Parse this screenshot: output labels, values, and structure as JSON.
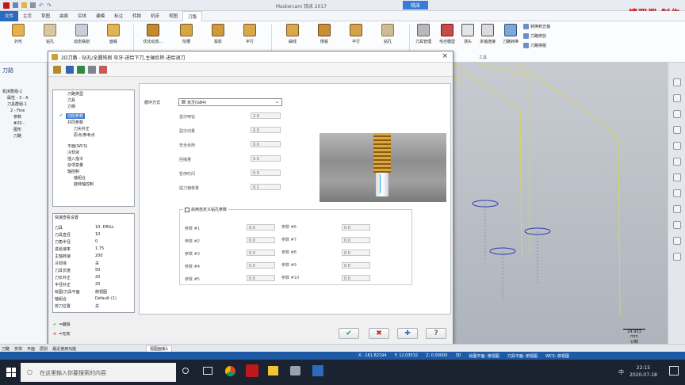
{
  "app": {
    "title": "Mastercam 铣床 2017",
    "ribbon_tab": "铣床",
    "brand": "禧瑕阁 制作"
  },
  "menu": [
    "文件",
    "主页",
    "草图",
    "曲面",
    "实体",
    "建模",
    "标注",
    "转换",
    "机床",
    "视图",
    "刀路"
  ],
  "ribbon": {
    "buttons": [
      "外形",
      "钻孔",
      "动态铣削",
      "面铣",
      "优化动态...",
      "挖槽",
      "投影",
      "平行",
      "曲线",
      "侧铣",
      "平行",
      "钻孔",
      "刀具管理",
      "毛坯模型",
      "测头",
      "多轴连接",
      "刀路转换"
    ],
    "tools": [
      "转换到五轴",
      "刀路修剪",
      "刀路排版"
    ],
    "group_label": "工具"
  },
  "left_panel": {
    "title": "刀路",
    "tree": [
      "机床群组-1",
      "属性 - 3 - A",
      "刀具群组-1",
      "2 - Fine",
      "参数",
      "#20 -",
      "图形",
      "刀路"
    ]
  },
  "dialog": {
    "title": "2D刀路 - 钻孔/全圆铣削 攻牙-进给下刀,主轴反转-进给退刀",
    "close": "×",
    "tree": [
      "刀路类型",
      "刀具",
      "刀柄",
      "切削参数",
      "共同参数",
      "刀尖补正",
      "原点/参考点",
      "平面(WCS)",
      "冷却液",
      "插入指令",
      "杂项变量",
      "轴控制",
      "轴组合",
      "旋转轴控制"
    ],
    "quick_view": {
      "title": "快速查看设置",
      "rows": [
        [
          "刀具",
          "10. DRILL"
        ],
        [
          "刀具直径",
          "10"
        ],
        [
          "刀角半径",
          "0"
        ],
        [
          "进给速率",
          "1.75"
        ],
        [
          "主轴转速",
          "200"
        ],
        [
          "冷却液",
          "关"
        ],
        [
          "刀具长度",
          "50"
        ],
        [
          "刀长补正",
          "20"
        ],
        [
          "半径补正",
          "20"
        ],
        [
          "绘图/刀具平面",
          "俯视图"
        ],
        [
          "轴组合",
          "Default (1)"
        ],
        [
          "校刀位置",
          "关"
        ]
      ]
    },
    "legend": {
      "edit": "=编辑",
      "disabled": "=无效"
    },
    "cycle_label": "循环方式",
    "cycle_value": "攻牙(G84)",
    "params": [
      [
        "首次啄钻",
        "2.0"
      ],
      [
        "副次切量",
        "0.0"
      ],
      [
        "安全余隙",
        "0.0"
      ],
      [
        "回缩量",
        "0.0"
      ],
      [
        "暂停时间",
        "0.0"
      ],
      [
        "提刀偏移量",
        "0.1"
      ]
    ],
    "custom_checkbox": "启用自定义钻孔参数",
    "custom_params_left": [
      [
        "参数 #1",
        "0.0"
      ],
      [
        "参数 #2",
        "0.0"
      ],
      [
        "参数 #3",
        "0.0"
      ],
      [
        "参数 #4",
        "0.0"
      ],
      [
        "参数 #5",
        "0.0"
      ]
    ],
    "custom_params_right": [
      [
        "参数 #6",
        "0.0"
      ],
      [
        "参数 #7",
        "0.0"
      ],
      [
        "参数 #8",
        "0.0"
      ],
      [
        "参数 #9",
        "0.0"
      ],
      [
        "参数 #10",
        "0.0"
      ]
    ]
  },
  "statusbar": {
    "tabs": [
      "刀路",
      "实体",
      "平面",
      "层别",
      "最近使用功能"
    ],
    "view_tab": "视图面板1",
    "scale": "24.933 mm",
    "unit": "公制"
  },
  "coordbar": {
    "x": "X: -161.82194",
    "y": "Y: 12.03532",
    "z": "Z: 0.00000",
    "mode": "3D",
    "draw_plane": "绘图平面: 俯视图",
    "tool_plane": "刀具平面: 俯视图",
    "wcs": "WCS: 俯视图"
  },
  "taskbar": {
    "search_placeholder": "在这里输入你要搜索的内容",
    "time": "22:15",
    "date": "2020-07-18",
    "ime": "中"
  },
  "colors": {
    "accent": "#2a6bbf",
    "brand": "#c0171c",
    "ok": "#2a9a3a",
    "cancel": "#c8232c",
    "help": "#2a6bbf"
  }
}
